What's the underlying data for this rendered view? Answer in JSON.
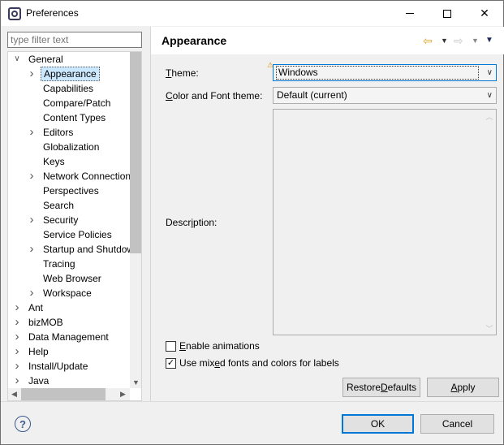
{
  "window": {
    "title": "Preferences"
  },
  "filter": {
    "placeholder": "type filter text"
  },
  "tree": {
    "items": [
      {
        "label": "General",
        "level": 0,
        "arrow": "down"
      },
      {
        "label": "Appearance",
        "level": 1,
        "arrow": "right",
        "selected": true
      },
      {
        "label": "Capabilities",
        "level": 1,
        "arrow": ""
      },
      {
        "label": "Compare/Patch",
        "level": 1,
        "arrow": ""
      },
      {
        "label": "Content Types",
        "level": 1,
        "arrow": ""
      },
      {
        "label": "Editors",
        "level": 1,
        "arrow": "right"
      },
      {
        "label": "Globalization",
        "level": 1,
        "arrow": ""
      },
      {
        "label": "Keys",
        "level": 1,
        "arrow": ""
      },
      {
        "label": "Network Connections",
        "level": 1,
        "arrow": "right"
      },
      {
        "label": "Perspectives",
        "level": 1,
        "arrow": ""
      },
      {
        "label": "Search",
        "level": 1,
        "arrow": ""
      },
      {
        "label": "Security",
        "level": 1,
        "arrow": "right"
      },
      {
        "label": "Service Policies",
        "level": 1,
        "arrow": ""
      },
      {
        "label": "Startup and Shutdown",
        "level": 1,
        "arrow": "right"
      },
      {
        "label": "Tracing",
        "level": 1,
        "arrow": ""
      },
      {
        "label": "Web Browser",
        "level": 1,
        "arrow": ""
      },
      {
        "label": "Workspace",
        "level": 1,
        "arrow": "right"
      },
      {
        "label": "Ant",
        "level": 0,
        "arrow": "right"
      },
      {
        "label": "bizMOB",
        "level": 0,
        "arrow": "right"
      },
      {
        "label": "Data Management",
        "level": 0,
        "arrow": "right"
      },
      {
        "label": "Help",
        "level": 0,
        "arrow": "right"
      },
      {
        "label": "Install/Update",
        "level": 0,
        "arrow": "right"
      },
      {
        "label": "Java",
        "level": 0,
        "arrow": "right"
      }
    ]
  },
  "page": {
    "title": "Appearance",
    "theme_label_first": "T",
    "theme_label_rest": "heme:",
    "theme_value": "Windows",
    "color_font_label_first": "C",
    "color_font_label_rest": "olor and Font theme:",
    "color_font_value": "Default (current)",
    "description_label_pre": "Descr",
    "description_label_u": "i",
    "description_label_post": "ption:",
    "enable_animations_first": "E",
    "enable_animations_rest": "nable animations",
    "enable_animations_checked": false,
    "mixed_fonts_pre": "Use mix",
    "mixed_fonts_u": "e",
    "mixed_fonts_post": "d fonts and colors for labels",
    "mixed_fonts_checked": true,
    "restore_defaults_pre": "Restore ",
    "restore_defaults_u": "D",
    "restore_defaults_post": "efaults",
    "apply_first": "A",
    "apply_rest": "pply"
  },
  "footer": {
    "ok_label": "OK",
    "cancel_label": "Cancel"
  },
  "colors": {
    "accent": "#0078d7",
    "selection": "#cce8ff",
    "warning": "#e08a00"
  }
}
